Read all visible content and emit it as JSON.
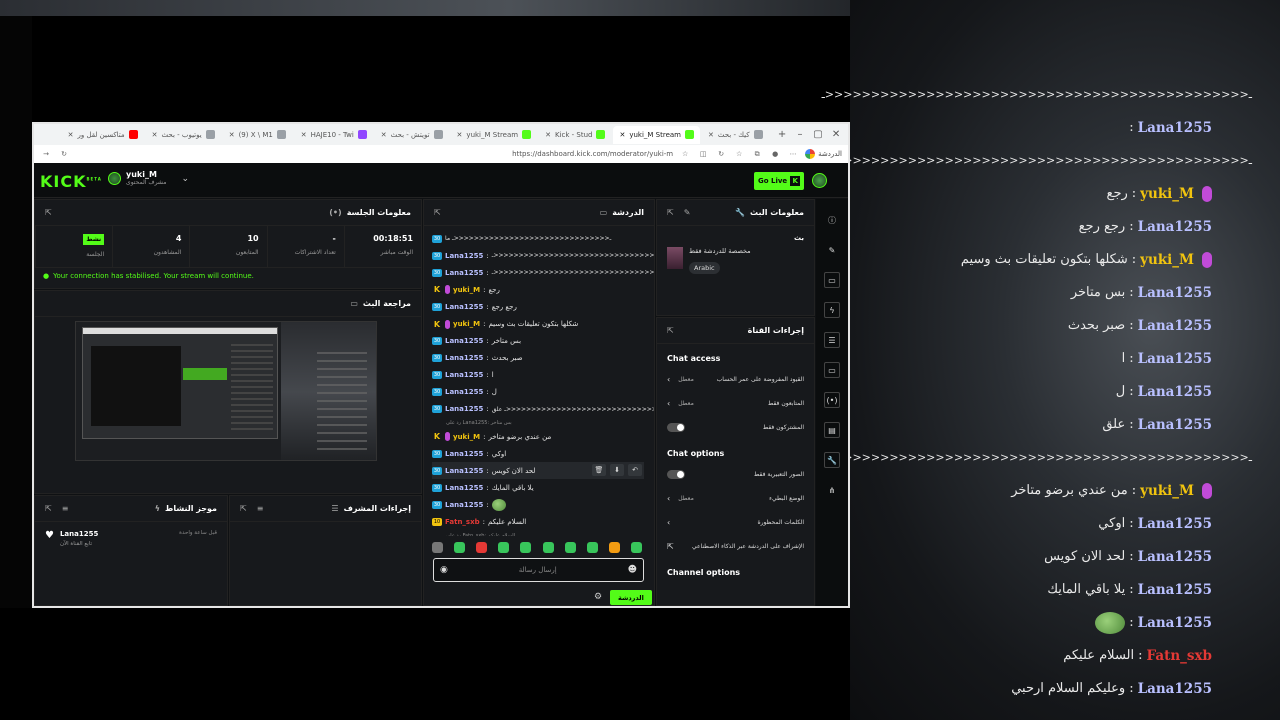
{
  "overlay_chat": [
    {
      "user": "",
      "text": "ـ<<<<<<<<<<<<<<<<<<<<<<<<<<<<<<<<<<<<<<<<<<<<<<ـ",
      "kind": "plain"
    },
    {
      "user": "Lana1255",
      "text": "",
      "kind": "normal"
    },
    {
      "user": "",
      "text": "ـ<<<<<<<<<<<<<<<<<<<<<<<<<<<<<<<<<<<<<<<<<<<<<<ـ",
      "kind": "plain"
    },
    {
      "user": "yuki_M",
      "text": "رجع",
      "kind": "brand"
    },
    {
      "user": "Lana1255",
      "text": "رجع رجع",
      "kind": "normal"
    },
    {
      "user": "yuki_M",
      "text": "شكلها بتكون تعليقات بث وسيم",
      "kind": "brand"
    },
    {
      "user": "Lana1255",
      "text": "بس متاخر",
      "kind": "normal"
    },
    {
      "user": "Lana1255",
      "text": "صبر بحدث",
      "kind": "normal"
    },
    {
      "user": "Lana1255",
      "text": "ا",
      "kind": "normal"
    },
    {
      "user": "Lana1255",
      "text": "ل",
      "kind": "normal"
    },
    {
      "user": "Lana1255",
      "text": "علق",
      "kind": "normal"
    },
    {
      "user": "",
      "text": "ـ<<<<<<<<<<<<<<<<<<<<<<<<<<<<<<<<<<<<<<<<<<<<<<ـ",
      "kind": "plain"
    },
    {
      "user": "yuki_M",
      "text": "من عندي برضو متاخر",
      "kind": "brand"
    },
    {
      "user": "Lana1255",
      "text": "اوكي",
      "kind": "normal"
    },
    {
      "user": "Lana1255",
      "text": "لحد الان كويس",
      "kind": "normal"
    },
    {
      "user": "Lana1255",
      "text": "يلا باقي المايك",
      "kind": "normal"
    },
    {
      "user": "Lana1255",
      "text": "",
      "kind": "emote"
    },
    {
      "user": "Fatn_sxb",
      "text": "السلام عليكم",
      "kind": "red"
    },
    {
      "user": "Lana1255",
      "text": "وعليكم السلام ارحبي",
      "kind": "normal"
    }
  ],
  "browser": {
    "tabs": [
      {
        "label": "كيك - بحث",
        "icon": "generic",
        "active": false
      },
      {
        "label": "yuki_M Stream",
        "icon": "kick",
        "active": true
      },
      {
        "label": "Kick - Stud",
        "icon": "kick",
        "active": false
      },
      {
        "label": "yuki_M Stream",
        "icon": "kick",
        "active": false
      },
      {
        "label": "تويتش - بحث",
        "icon": "generic",
        "active": false
      },
      {
        "label": "HAJE10 - Twi",
        "icon": "twitch",
        "active": false
      },
      {
        "label": "(9) X \\ M1",
        "icon": "generic",
        "active": false
      },
      {
        "label": "يوتيوب - بحث",
        "icon": "generic",
        "active": false
      },
      {
        "label": "متاكسين لقل ور",
        "icon": "youtube",
        "active": false
      }
    ],
    "url": "https://dashboard.kick.com/moderator/yuki-m",
    "profile_label": "الدردشة"
  },
  "kick": {
    "logo": "KICK",
    "logo_beta": "BETA",
    "channel_name": "yuki_M",
    "channel_role": "مشرف المحتوى",
    "go_live": "Go Live",
    "session": {
      "title": "معلومات الجلسة",
      "stats": [
        {
          "value": "00:18:51",
          "label": "الوقت مباشر"
        },
        {
          "value": "-",
          "label": "تعداد الاشتراكات"
        },
        {
          "value": "10",
          "label": "المتابعون"
        },
        {
          "value": "4",
          "label": "المشاهدون"
        },
        {
          "value": "",
          "label": "الجلسة",
          "badge": "نشط"
        }
      ],
      "connection": "Your connection has stabilised. Your stream will continue."
    },
    "preview_title": "مراجعة البث",
    "activity": {
      "title": "موجز النشاط",
      "item_name": "Lana1255",
      "item_sub": "تابع القناة الآن",
      "item_time": "قبل ساعة واحدة"
    },
    "mod_log_title": "إجراءات المشرف",
    "chat": {
      "title": "الدردشة",
      "input_placeholder": "إرسال رسالة",
      "send": "الدردشة",
      "messages": [
        {
          "user": "",
          "text": "ـ<<<<<<<<<<<<<<<<<<<<<<<<<<<<<<<ـ ما",
          "badge": "sub",
          "kind": "cut"
        },
        {
          "user": "Lana1255",
          "text": "ـ<<<<<<<<<<<<<<<<<<<<<<<<<<<<<<<<ـ",
          "badge": "sub",
          "kind": "normal"
        },
        {
          "user": "Lana1255",
          "text": "ـ<<<<<<<<<<<<<<<<<<<<<<<<<<<<<<<<<ـ",
          "badge": "sub",
          "kind": "normal"
        },
        {
          "user": "yuki_M",
          "text": "رجع",
          "badge": "brand",
          "kind": "brand"
        },
        {
          "user": "Lana1255",
          "text": "رجع رجع",
          "badge": "sub",
          "kind": "normal"
        },
        {
          "user": "yuki_M",
          "text": "شكلها بتكون تعليقات بث وسيم",
          "badge": "brand",
          "kind": "brand"
        },
        {
          "user": "Lana1255",
          "text": "بس متاخر",
          "badge": "sub",
          "kind": "normal"
        },
        {
          "user": "Lana1255",
          "text": "صبر بحدث",
          "badge": "sub",
          "kind": "normal"
        },
        {
          "user": "Lana1255",
          "text": "ا",
          "badge": "sub",
          "kind": "normal"
        },
        {
          "user": "Lana1255",
          "text": "ل",
          "badge": "sub",
          "kind": "normal"
        },
        {
          "user": "Lana1255",
          "text": "ـ<<<<<<<<<<<<<<<<<<<<<<<<<<<<<<<<<<ـ علق",
          "badge": "sub",
          "kind": "normal"
        },
        {
          "user": "",
          "text": "رد على Lana1255: بس متاخر",
          "badge": "",
          "kind": "reply"
        },
        {
          "user": "yuki_M",
          "text": "من عندي برضو متاخر",
          "badge": "brand",
          "kind": "brand"
        },
        {
          "user": "Lana1255",
          "text": "اوكي",
          "badge": "sub",
          "kind": "normal"
        },
        {
          "user": "Lana1255",
          "text": "لحد الان كويس",
          "badge": "sub",
          "kind": "highlight"
        },
        {
          "user": "Lana1255",
          "text": "يلا باقي المايك",
          "badge": "sub",
          "kind": "normal"
        },
        {
          "user": "Lana1255",
          "text": "",
          "badge": "sub",
          "kind": "emote"
        },
        {
          "user": "Fatn_sxb",
          "text": "السلام عليكم",
          "badge": "subyellow",
          "kind": "red"
        },
        {
          "user": "",
          "text": "رد على Fatn_sxb: السلام عليكم",
          "badge": "",
          "kind": "reply"
        },
        {
          "user": "Lana1255",
          "text": "وعليكم السلام ارحبي",
          "badge": "sub",
          "kind": "normal"
        }
      ]
    },
    "stream_info": {
      "title": "معلومات البث",
      "label": "بث",
      "stream_title": "مخصصة للدردشة فقط",
      "tag": "Arabic"
    },
    "mod_actions": {
      "title": "إجراءات القناة",
      "chat_access": "Chat access",
      "rows_access": [
        {
          "label": "القيود المفروضة على عمر الحساب",
          "value": "معطل",
          "type": "chevron"
        },
        {
          "label": "المتابعون فقط",
          "value": "معطل",
          "type": "chevron"
        },
        {
          "label": "المشتركون فقط",
          "value": "",
          "type": "toggle"
        }
      ],
      "chat_options": "Chat options",
      "rows_options": [
        {
          "label": "الصور التعبيرية فقط",
          "value": "",
          "type": "toggle"
        },
        {
          "label": "الوضع البطيء",
          "value": "معطل",
          "type": "chevron"
        },
        {
          "label": "الكلمات المحظورة",
          "value": "",
          "type": "chevron"
        },
        {
          "label": "الإشراف على الدردشة عبر الذكاء الاصطناعي",
          "value": "",
          "type": "external"
        }
      ],
      "channel_options": "Channel options"
    }
  }
}
